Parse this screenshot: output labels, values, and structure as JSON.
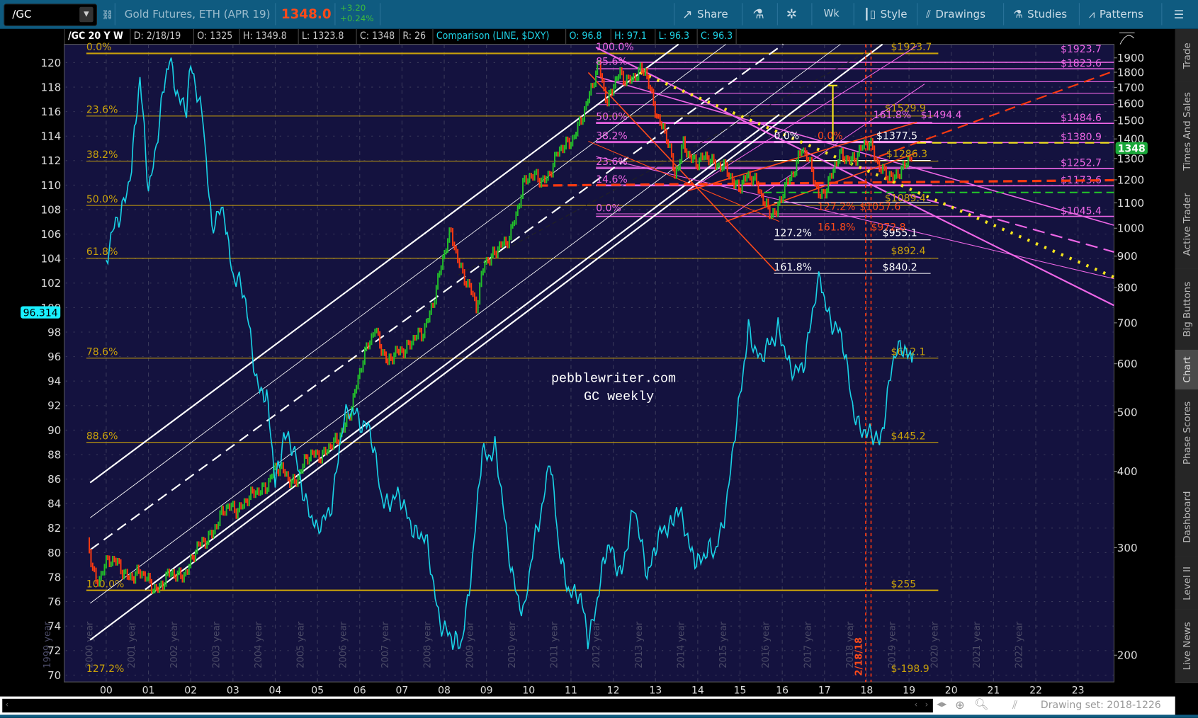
{
  "toolbar": {
    "symbol": "/GC",
    "description": "Gold Futures, ETH (APR 19)",
    "last_price": "1348.0",
    "change": "+3.20",
    "change_pct": "+0.24%",
    "share": "Share",
    "timeframe": "Wk",
    "style": "Style",
    "drawings": "Drawings",
    "studies": "Studies",
    "patterns": "Patterns"
  },
  "info_bar": {
    "title": "/GC 20 Y W",
    "date": "D: 2/18/19",
    "open": "O: 1325",
    "high": "H: 1349.8",
    "low": "L: 1323.8",
    "close": "C: 1348",
    "range": "R: 26",
    "comparison": "Comparison (LINE, $DXY)",
    "cmp_open": "O: 96.8",
    "cmp_high": "H: 97.1",
    "cmp_low": "L: 96.3",
    "cmp_close": "C: 96.3"
  },
  "sidebar": {
    "tabs": [
      {
        "label": "Trade"
      },
      {
        "label": "Times And Sales"
      },
      {
        "label": "Active Trader"
      },
      {
        "label": "Big Buttons"
      },
      {
        "label": "Chart"
      },
      {
        "label": "Phase Scores"
      },
      {
        "label": "Dashboard"
      },
      {
        "label": "Level II"
      },
      {
        "label": "Live News"
      }
    ],
    "active": "Chart"
  },
  "status_bar": {
    "drawing_set": "Drawing set: 2018-1226"
  },
  "watermark": {
    "line1": "pebblewriter.com",
    "line2": "GC weekly"
  },
  "colors": {
    "plot_bg": "#14123f",
    "dxy": "#19d3e6",
    "up": "#22c02a",
    "down": "#ff3a10",
    "fib_yellow": "#c9a10a",
    "magenta": "#ee66e6",
    "badge_gold": "#1aa83a",
    "badge_dxy": "#19f0ff"
  },
  "chart_data": {
    "type": "line",
    "title": "/GC 20 Y W",
    "x_tick_labels": [
      "00",
      "01",
      "02",
      "03",
      "04",
      "05",
      "06",
      "07",
      "08",
      "09",
      "10",
      "11",
      "12",
      "13",
      "14",
      "15",
      "16",
      "17",
      "18",
      "19",
      "20",
      "21",
      "22",
      "23"
    ],
    "year_labels": [
      "1999 year",
      "2000 year",
      "2001 year",
      "2002 year",
      "2003 year",
      "2004 year",
      "2005 year",
      "2006 year",
      "2007 year",
      "2008 year",
      "2009 year",
      "2010 year",
      "2011 year",
      "2012 year",
      "2013 year",
      "2014 year",
      "2015 year",
      "2016 year",
      "2017 year",
      "2018 year",
      "2019 year",
      "2020 year",
      "2021 year",
      "2022 year"
    ],
    "left_axis": {
      "label": "$DXY",
      "range": [
        70,
        121
      ],
      "ticks": [
        "120",
        "118",
        "116",
        "114",
        "112",
        "110",
        "108",
        "106",
        "104",
        "102",
        "100",
        "98",
        "96",
        "94",
        "92",
        "90",
        "88",
        "86",
        "84",
        "82",
        "80",
        "78",
        "76",
        "74",
        "72",
        "70"
      ],
      "current": "96.314"
    },
    "right_axis": {
      "label": "Gold",
      "scale": "log",
      "range": [
        180,
        2000
      ],
      "ticks": [
        "1900",
        "1800",
        "1700",
        "1600",
        "1500",
        "1400",
        "1300",
        "1200",
        "1100",
        "1000",
        "900",
        "800",
        "700",
        "600",
        "500",
        "400",
        "300",
        "200"
      ],
      "current": "1348"
    },
    "series": [
      {
        "name": "$DXY",
        "axis": "left",
        "style": "line",
        "x": [
          2000.0,
          2000.3,
          2000.6,
          2000.8,
          2001.0,
          2001.3,
          2001.5,
          2001.9,
          2002.0,
          2002.3,
          2002.5,
          2002.8,
          2003.0,
          2003.3,
          2003.6,
          2003.8,
          2004.0,
          2004.2,
          2004.5,
          2004.8,
          2005.0,
          2005.3,
          2005.6,
          2005.9,
          2006.2,
          2006.5,
          2006.9,
          2007.2,
          2007.6,
          2007.9,
          2008.2,
          2008.4,
          2008.7,
          2008.9,
          2009.2,
          2009.5,
          2009.9,
          2010.2,
          2010.5,
          2010.7,
          2010.9,
          2011.2,
          2011.4,
          2011.7,
          2011.9,
          2012.2,
          2012.5,
          2012.8,
          2013.0,
          2013.5,
          2013.8,
          2014.0,
          2014.4,
          2014.7,
          2015.0,
          2015.2,
          2015.5,
          2015.9,
          2016.2,
          2016.5,
          2016.9,
          2017.0,
          2017.4,
          2017.7,
          2018.0,
          2018.3,
          2018.6,
          2018.9,
          2019.1
        ],
        "values": [
          104,
          107,
          112,
          118,
          110,
          116,
          120,
          116,
          119,
          116,
          106,
          108,
          103,
          100,
          94,
          92,
          86,
          90,
          87,
          84,
          81,
          84,
          90,
          92,
          90,
          85,
          84,
          83,
          80,
          75,
          72,
          73,
          80,
          88,
          89,
          80,
          75,
          82,
          88,
          80,
          78,
          76,
          73,
          78,
          80,
          79,
          83,
          79,
          80,
          84,
          80,
          80,
          79.5,
          85,
          92,
          99,
          95,
          99,
          94,
          96,
          102,
          101,
          97,
          92,
          89,
          89.5,
          95,
          97,
          96.3
        ]
      },
      {
        "name": "/GC",
        "axis": "right",
        "style": "candles",
        "x": [
          1999.6,
          1999.8,
          2000.0,
          2000.5,
          2001.0,
          2001.3,
          2002.0,
          2002.5,
          2003.0,
          2003.5,
          2004.0,
          2004.5,
          2005.0,
          2005.5,
          2006.0,
          2006.4,
          2006.7,
          2007.0,
          2007.5,
          2008.2,
          2008.8,
          2009.0,
          2009.5,
          2009.9,
          2010.5,
          2011.0,
          2011.4,
          2011.7,
          2011.9,
          2012.2,
          2012.8,
          2013.3,
          2013.5,
          2013.7,
          2014.0,
          2014.3,
          2014.9,
          2015.2,
          2015.9,
          2016.5,
          2016.9,
          2017.4,
          2017.9,
          2018.1,
          2018.7,
          2019.1
        ],
        "values": [
          300,
          265,
          285,
          275,
          265,
          260,
          280,
          320,
          350,
          360,
          400,
          390,
          430,
          440,
          560,
          700,
          590,
          640,
          660,
          980,
          730,
          900,
          930,
          1180,
          1230,
          1400,
          1550,
          1900,
          1600,
          1780,
          1780,
          1400,
          1200,
          1400,
          1250,
          1330,
          1180,
          1220,
          1050,
          1370,
          1130,
          1290,
          1340,
          1360,
          1180,
          1348
        ]
      }
    ],
    "fib_dxy": [
      {
        "pct": "0.0%",
        "value": 120.75,
        "price": "$1923.7"
      },
      {
        "pct": "23.6%",
        "value": 115.64,
        "price": ""
      },
      {
        "pct": "38.2%",
        "value": 111.96,
        "price": ""
      },
      {
        "pct": "50.0%",
        "value": 108.34,
        "price": ""
      },
      {
        "pct": "61.8%",
        "value": 104.04,
        "price": ""
      },
      {
        "pct": "78.6%",
        "value": 95.87,
        "price": "$612.1"
      },
      {
        "pct": "88.6%",
        "value": 89.0,
        "price": "$445.2"
      },
      {
        "pct": "100.0%",
        "value": 76.92,
        "price": "$255"
      },
      {
        "pct": "127.2%",
        "value": 70.0,
        "price": "$-198.9"
      }
    ],
    "gold_levels": [
      {
        "label": "$1923.7",
        "price": 1923.7
      },
      {
        "label": "$1823.6",
        "price": 1823.6
      },
      {
        "label": "$1484.6",
        "price": 1484.6
      },
      {
        "label": "$1380.9",
        "price": 1380.9
      },
      {
        "label": "$1252.7",
        "price": 1252.7
      },
      {
        "label": "$1173.6",
        "price": 1173.6
      },
      {
        "label": "$1045.4",
        "price": 1045.4
      }
    ],
    "annotations": [
      {
        "text": "100.0%",
        "color": "magenta"
      },
      {
        "text": "85.6%",
        "color": "magenta"
      },
      {
        "text": "50.0%",
        "color": "magenta"
      },
      {
        "text": "38.2%",
        "color": "magenta"
      },
      {
        "text": "23.6%",
        "color": "magenta"
      },
      {
        "text": "14.6%",
        "color": "magenta"
      },
      {
        "text": "0.0%",
        "color": "magenta"
      },
      {
        "text": "0.0%",
        "color": "white"
      },
      {
        "text": "127.2%",
        "color": "white"
      },
      {
        "text": "161.8%",
        "color": "white"
      },
      {
        "text": "$1377.5",
        "color": "white"
      },
      {
        "text": "$955.1",
        "color": "white"
      },
      {
        "text": "$840.2",
        "color": "white"
      },
      {
        "text": "$1529.9",
        "color": "gold"
      },
      {
        "text": "$1286.3",
        "color": "gold"
      },
      {
        "text": "$1089.4",
        "color": "gold"
      },
      {
        "text": "$892.4",
        "color": "gold"
      },
      {
        "text": "0.0%",
        "color": "red"
      },
      {
        "text": "127.2%",
        "color": "red"
      },
      {
        "text": "$1057.6",
        "color": "red"
      },
      {
        "text": "161.8%",
        "color": "red"
      },
      {
        "text": "$972.8",
        "color": "red"
      },
      {
        "text": "161.8%",
        "color": "magenta"
      },
      {
        "text": "$1494.4",
        "color": "magenta"
      },
      {
        "text": "2/18/18",
        "color": "red"
      }
    ]
  }
}
